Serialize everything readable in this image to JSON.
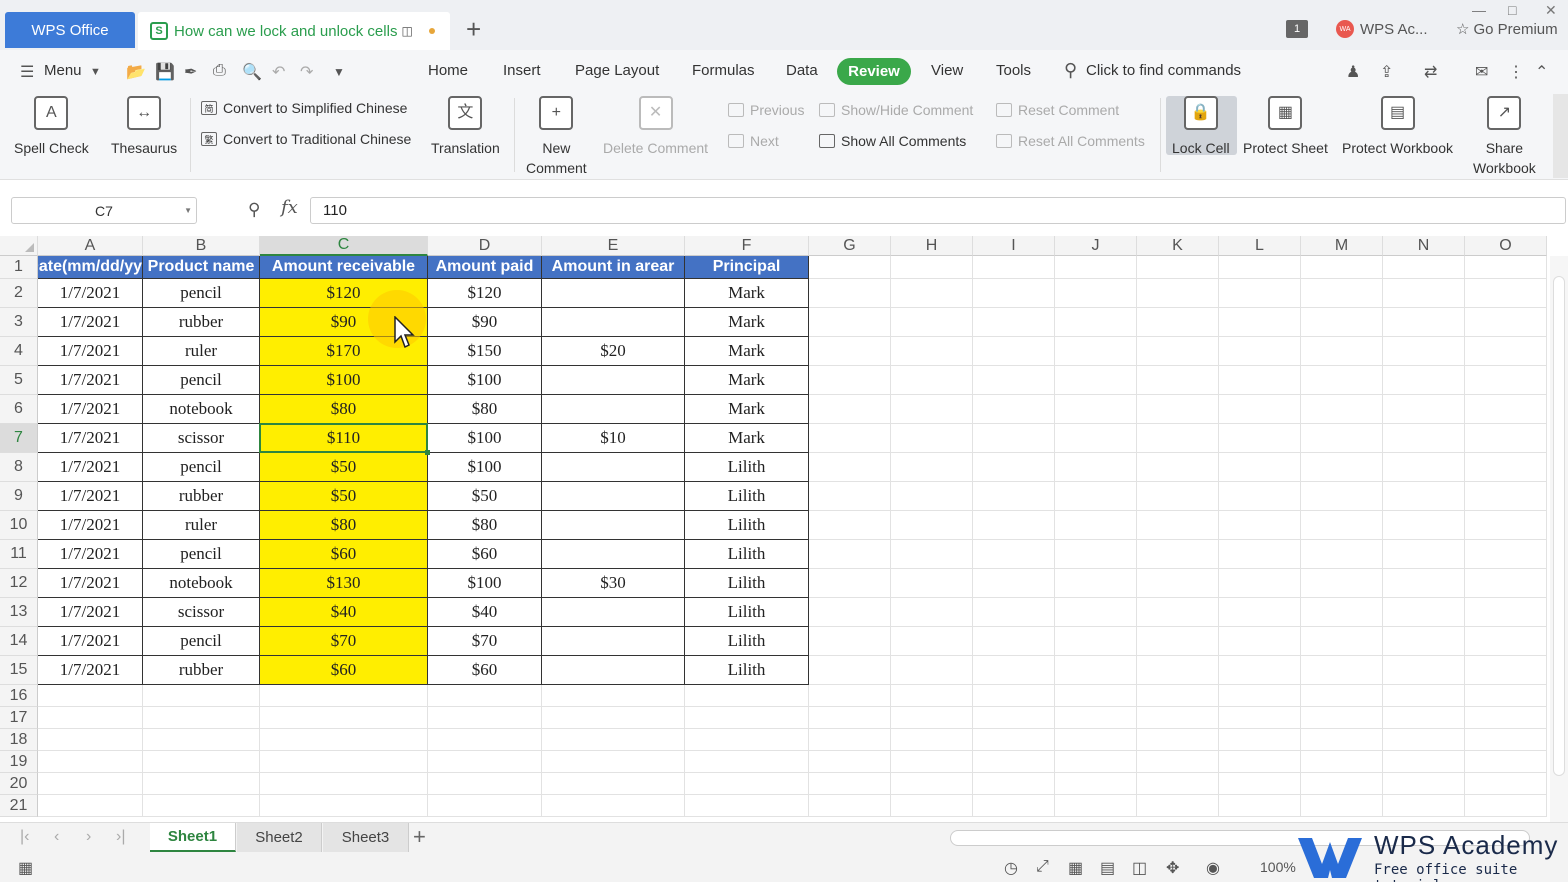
{
  "titlebar": {
    "app_tab": "WPS Office",
    "doc_tab": "How can we lock and unlock cells",
    "doc_badge": "S",
    "tab_count": "1",
    "account": "WPS Ac...",
    "premium": "Go Premium"
  },
  "menubar": {
    "menu_label": "Menu",
    "tabs": [
      "Home",
      "Insert",
      "Page Layout",
      "Formulas",
      "Data",
      "Review",
      "View",
      "Tools"
    ],
    "active_tab": "Review",
    "search": "Click to find commands"
  },
  "ribbon": {
    "spell_check": "Spell Check",
    "thesaurus": "Thesaurus",
    "to_simplified": "Convert to Simplified Chinese",
    "to_traditional": "Convert to Traditional Chinese",
    "translation": "Translation",
    "new_comment_1": "New",
    "new_comment_2": "Comment",
    "delete_comment": "Delete Comment",
    "previous": "Previous",
    "next": "Next",
    "show_hide_comment": "Show/Hide Comment",
    "show_all_comments": "Show All Comments",
    "reset_comment": "Reset Comment",
    "reset_all_comments": "Reset All Comments",
    "lock_cell": "Lock Cell",
    "protect_sheet": "Protect Sheet",
    "protect_workbook": "Protect Workbook",
    "share_workbook_1": "Share",
    "share_workbook_2": "Workbook"
  },
  "formula_bar": {
    "name_box": "C7",
    "fx": "fx",
    "value": "110"
  },
  "sheet": {
    "columns": [
      "A",
      "B",
      "C",
      "D",
      "E",
      "F",
      "G",
      "H",
      "I",
      "J",
      "K",
      "L",
      "M",
      "N",
      "O"
    ],
    "selected_column": "C",
    "selected_row": "7",
    "row_numbers": [
      "1",
      "2",
      "3",
      "4",
      "5",
      "6",
      "7",
      "8",
      "9",
      "10",
      "11",
      "12",
      "13",
      "14",
      "15",
      "16",
      "17",
      "18",
      "19",
      "20",
      "21"
    ],
    "headers": [
      "Date(mm/dd/yy",
      "Product name",
      "Amount receivable",
      "Amount paid",
      "Amount in arear",
      "Principal"
    ],
    "rows": [
      [
        "1/7/2021",
        "pencil",
        "$120",
        "$120",
        "",
        "Mark"
      ],
      [
        "1/7/2021",
        "rubber",
        "$90",
        "$90",
        "",
        "Mark"
      ],
      [
        "1/7/2021",
        "ruler",
        "$170",
        "$150",
        "$20",
        "Mark"
      ],
      [
        "1/7/2021",
        "pencil",
        "$100",
        "$100",
        "",
        "Mark"
      ],
      [
        "1/7/2021",
        "notebook",
        "$80",
        "$80",
        "",
        "Mark"
      ],
      [
        "1/7/2021",
        "scissor",
        "$110",
        "$100",
        "$10",
        "Mark"
      ],
      [
        "1/7/2021",
        "pencil",
        "$50",
        "$100",
        "",
        "Lilith"
      ],
      [
        "1/7/2021",
        "rubber",
        "$50",
        "$50",
        "",
        "Lilith"
      ],
      [
        "1/7/2021",
        "ruler",
        "$80",
        "$80",
        "",
        "Lilith"
      ],
      [
        "1/7/2021",
        "pencil",
        "$60",
        "$60",
        "",
        "Lilith"
      ],
      [
        "1/7/2021",
        "notebook",
        "$130",
        "$100",
        "$30",
        "Lilith"
      ],
      [
        "1/7/2021",
        "scissor",
        "$40",
        "$40",
        "",
        "Lilith"
      ],
      [
        "1/7/2021",
        "pencil",
        "$70",
        "$70",
        "",
        "Lilith"
      ],
      [
        "1/7/2021",
        "rubber",
        "$60",
        "$60",
        "",
        "Lilith"
      ]
    ]
  },
  "sheet_tabs": [
    "Sheet1",
    "Sheet2",
    "Sheet3"
  ],
  "active_sheet": "Sheet1",
  "status": {
    "zoom": "100%"
  },
  "watermark": {
    "title": "WPS Academy",
    "subtitle": "Free office suite tutorials"
  },
  "colors": {
    "accent": "#3aa84a",
    "header_fill": "#4472c4",
    "highlight": "#ffee00",
    "app_tab": "#3d7bd8"
  }
}
